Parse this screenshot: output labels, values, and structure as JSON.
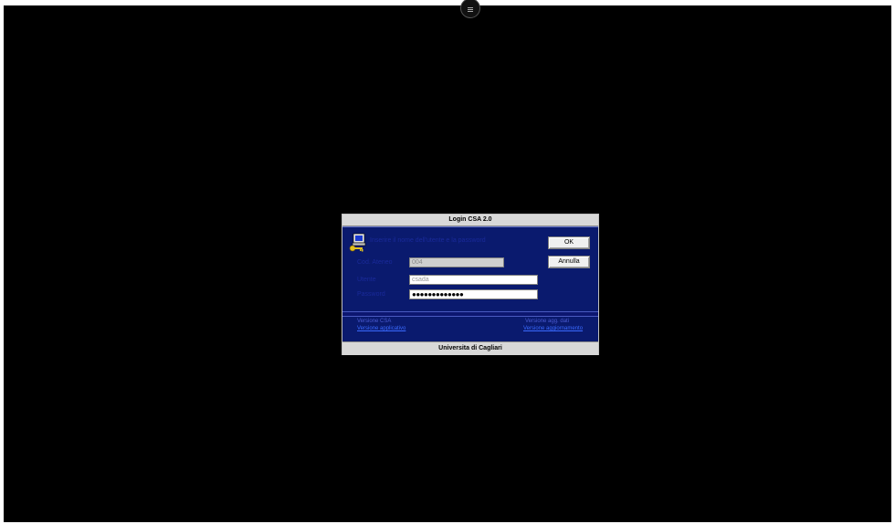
{
  "dialog": {
    "title": "Login CSA 2.0",
    "prompt": "Inserire il nome dell'utente e la password",
    "ok_label": "OK",
    "cancel_label": "Annulla",
    "footer": "Universita di Cagliari"
  },
  "fields": {
    "ateneo_label": "Cod. Ateneo",
    "ateneo_value": "004",
    "utente_label": "Utente",
    "utente_value": "csada",
    "password_label": "Password",
    "password_value": "●●●●●●●●●●●●●"
  },
  "versions": {
    "csa_label": "Versione CSA",
    "csa_link": "Versione applicativo",
    "agg_label": "Versione agg. dati",
    "agg_link": "Versione aggiornamento"
  },
  "colors": {
    "desktop": "#000000",
    "dialog_body": "#0a1a6e",
    "label_text": "#1a2a9a",
    "link_text": "#3a6aff"
  },
  "icons": {
    "login": "user-key-icon",
    "top_handle": "menu-handle-icon"
  }
}
